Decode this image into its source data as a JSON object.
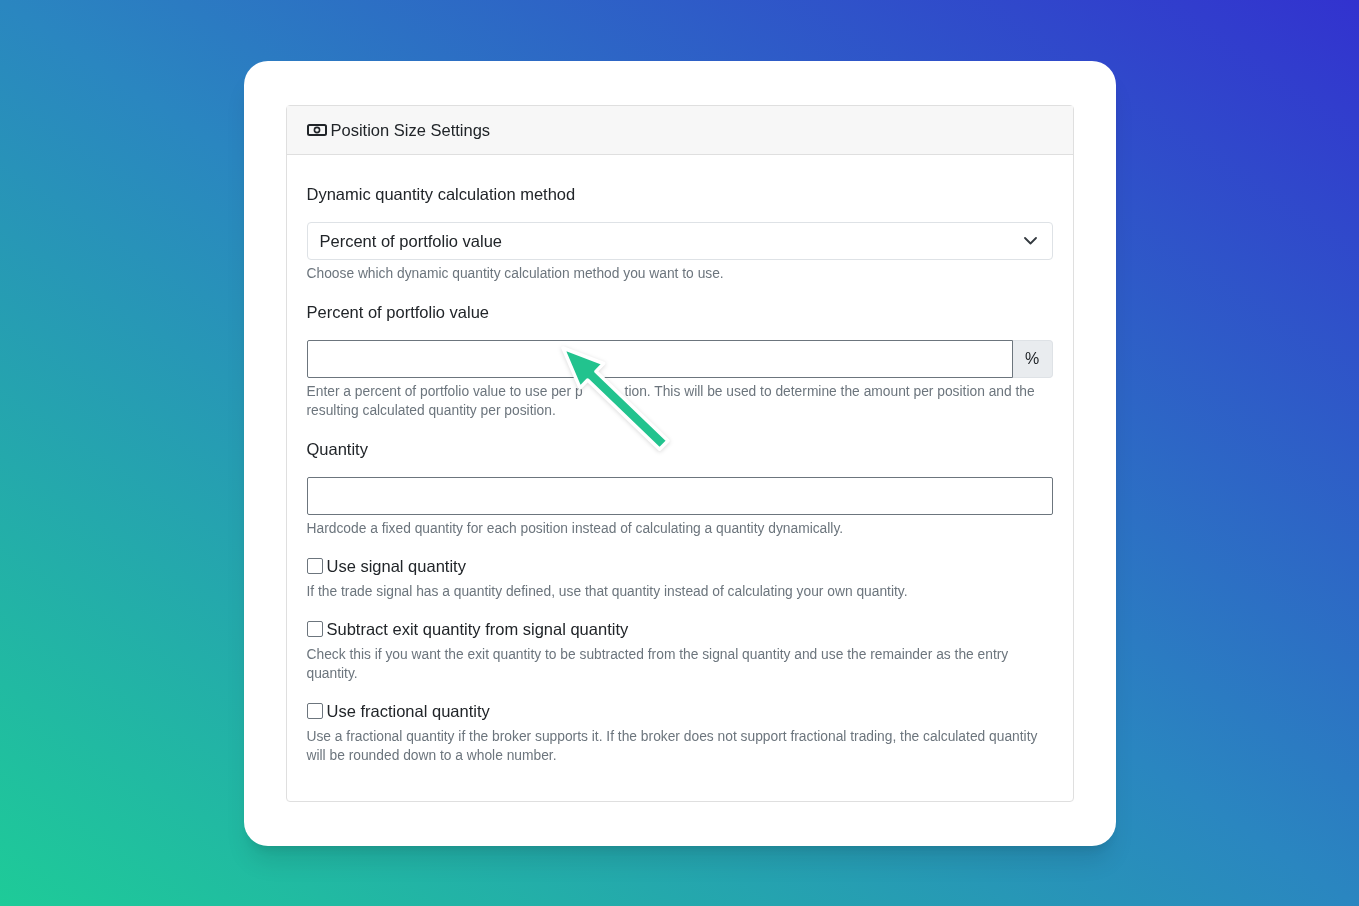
{
  "panel": {
    "title": "Position Size Settings"
  },
  "fields": [
    {
      "kind": "select",
      "label": "Dynamic quantity calculation method",
      "value": "Percent of portfolio value",
      "help": "Choose which dynamic quantity calculation method you want to use."
    },
    {
      "kind": "input",
      "label": "Percent of portfolio value",
      "addon": "%",
      "help": [
        "Enter a percent of portfolio value to use per p",
        "tion. This will be used to determine the amount per position and the resulting calculated quantity per position."
      ]
    },
    {
      "kind": "input",
      "label": "Quantity",
      "help": "Hardcode a fixed quantity for each position instead of calculating a quantity dynamically."
    }
  ],
  "options": [
    {
      "label": "Use signal quantity",
      "checked": false,
      "help": "If the trade signal has a quantity defined, use that quantity instead of calculating your own quantity."
    },
    {
      "label": "Subtract exit quantity from signal quantity",
      "checked": false,
      "help": "Check this if you want the exit quantity to be subtracted from the signal quantity and use the remainder as the entry quantity."
    },
    {
      "label": "Use fractional quantity",
      "checked": false,
      "help": "Use a fractional quantity if the broker supports it. If the broker does not support fractional trading, the calculated quantity will be rounded down to a whole number."
    }
  ]
}
